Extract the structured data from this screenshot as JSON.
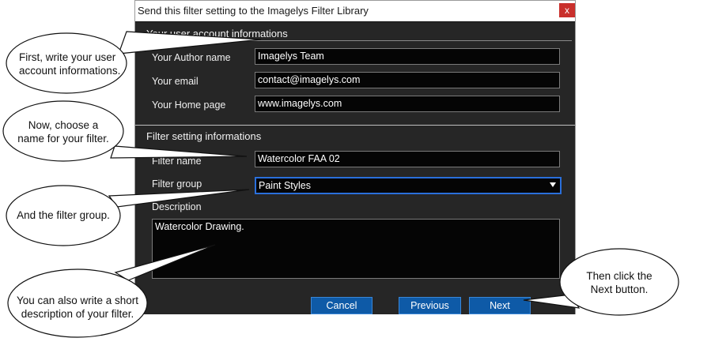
{
  "dialog": {
    "title": "Send this filter setting to the Imagelys Filter Library",
    "close_glyph": "x",
    "section_user": "Your user account informations",
    "author_label": "Your Author name",
    "author_value": "Imagelys Team",
    "email_label": "Your email",
    "email_value": "contact@imagelys.com",
    "homepage_label": "Your Home page",
    "homepage_value": "www.imagelys.com",
    "section_filter": "Filter setting informations",
    "filter_name_label": "Filter name",
    "filter_name_value": "Watercolor FAA 02",
    "filter_group_label": "Filter group",
    "filter_group_value": "Paint Styles",
    "description_label": "Description",
    "description_value": "Watercolor Drawing.",
    "cancel_label": "Cancel",
    "previous_label": "Previous",
    "next_label": "Next"
  },
  "callouts": {
    "c1_line1": "First, write your user",
    "c1_line2": "account informations.",
    "c2_line1": "Now, choose a",
    "c2_line2": "name for your filter.",
    "c3_line1": "And the filter group.",
    "c4_line1": "You can also write a short",
    "c4_line2": "description of your filter.",
    "c5_line1": "Then click the",
    "c5_line2": "Next button."
  }
}
